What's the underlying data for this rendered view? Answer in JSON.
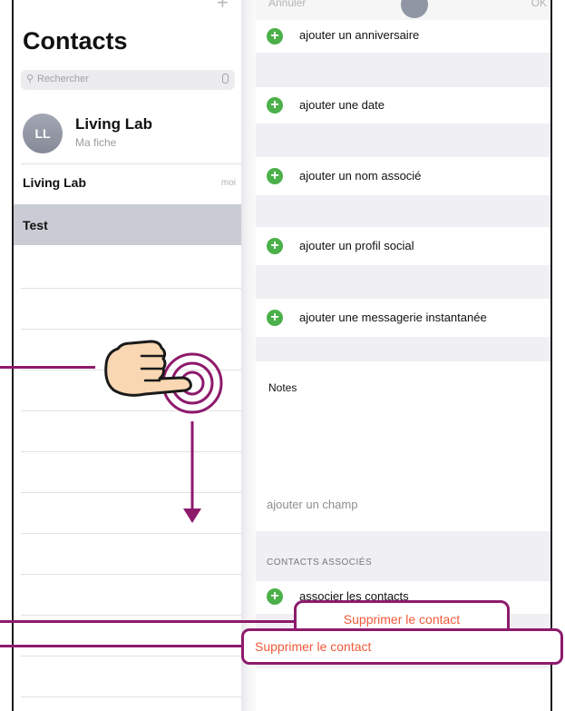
{
  "left_pane": {
    "title": "Contacts",
    "search_placeholder": "Rechercher",
    "my_card": {
      "initials": "LL",
      "name": "Living Lab",
      "subtitle": "Ma fiche"
    },
    "contacts": [
      {
        "name": "Living Lab",
        "tag": "moi"
      },
      {
        "name": "Test"
      }
    ]
  },
  "right_pane": {
    "top_left": "Annuler",
    "top_right": "OK",
    "add_fields": [
      "ajouter un anniversaire",
      "ajouter une date",
      "ajouter un nom associé",
      "ajouter un profil social",
      "ajouter une messagerie instantanée"
    ],
    "notes_label": "Notes",
    "add_field": "ajouter un champ",
    "section_header": "CONTACTS ASSOCIÉS",
    "link_contacts": "associer les contacts"
  },
  "popover": {
    "label": "Supprimer le contact"
  },
  "delete_action": {
    "label": "Supprimer le contact"
  },
  "colors": {
    "annotation": "#8e1a6c",
    "destructive": "#ef5b3a",
    "add_green": "#4cb04a"
  }
}
